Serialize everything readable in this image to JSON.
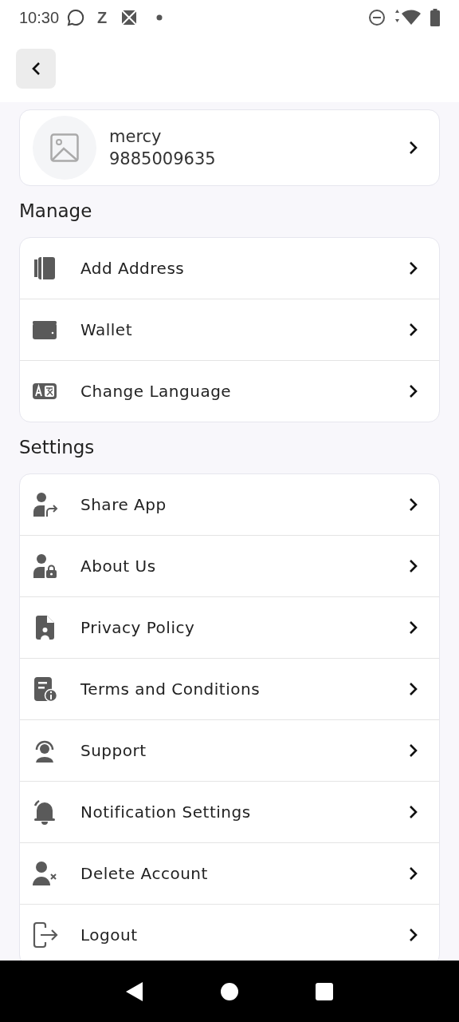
{
  "status_bar": {
    "time": "10:30",
    "notification_letter": "Z"
  },
  "profile": {
    "name": "mercy",
    "phone": "9885009635"
  },
  "sections": [
    {
      "title": "Manage",
      "items": [
        {
          "label": "Add Address"
        },
        {
          "label": "Wallet"
        },
        {
          "label": "Change Language"
        }
      ]
    },
    {
      "title": "Settings",
      "items": [
        {
          "label": "Share App"
        },
        {
          "label": "About Us"
        },
        {
          "label": "Privacy Policy"
        },
        {
          "label": "Terms and Conditions"
        },
        {
          "label": "Support"
        },
        {
          "label": "Notification Settings"
        },
        {
          "label": "Delete Account"
        },
        {
          "label": "Logout"
        }
      ]
    }
  ]
}
